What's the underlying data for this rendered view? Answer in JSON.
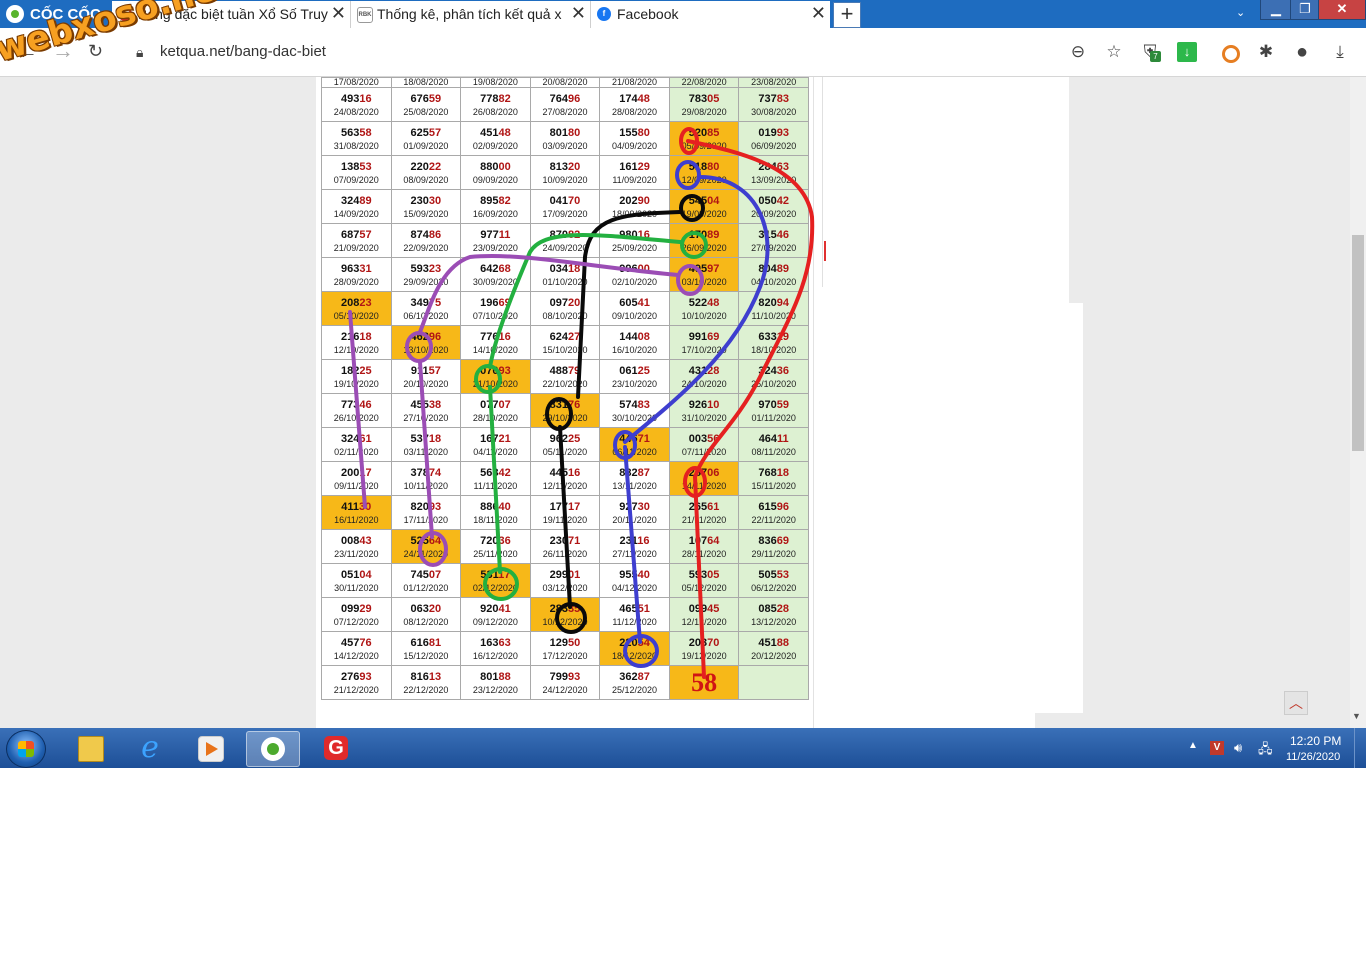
{
  "browser": {
    "brand": "CỐC CỐC",
    "tabs": [
      {
        "title": "Bảng đặc biệt tuần Xổ Số Truy"
      },
      {
        "title": "Thống kê, phân tích kết quả x"
      },
      {
        "title": "Facebook"
      }
    ],
    "new_tab": "+",
    "url": "ketqua.net/bang-dac-biet",
    "ext_badge": "7"
  },
  "watermark": "webxoso.net",
  "table": {
    "first_row": [
      "17/08/2020",
      "18/08/2020",
      "19/08/2020",
      "20/08/2020",
      "21/08/2020",
      "22/08/2020",
      "23/08/2020"
    ],
    "rows": [
      [
        [
          "49316",
          "24/08/2020"
        ],
        [
          "67659",
          "25/08/2020"
        ],
        [
          "77882",
          "26/08/2020"
        ],
        [
          "76496",
          "27/08/2020"
        ],
        [
          "17448",
          "28/08/2020"
        ],
        [
          "78305",
          "29/08/2020"
        ],
        [
          "73783",
          "30/08/2020"
        ]
      ],
      [
        [
          "56358",
          "31/08/2020"
        ],
        [
          "62557",
          "01/09/2020"
        ],
        [
          "45148",
          "02/09/2020"
        ],
        [
          "80180",
          "03/09/2020"
        ],
        [
          "15580",
          "04/09/2020"
        ],
        [
          "52085",
          "05/09/2020"
        ],
        [
          "01993",
          "06/09/2020"
        ]
      ],
      [
        [
          "13853",
          "07/09/2020"
        ],
        [
          "22022",
          "08/09/2020"
        ],
        [
          "88000",
          "09/09/2020"
        ],
        [
          "81320",
          "10/09/2020"
        ],
        [
          "16129",
          "11/09/2020"
        ],
        [
          "51880",
          "12/09/2020"
        ],
        [
          "28463",
          "13/09/2020"
        ]
      ],
      [
        [
          "32489",
          "14/09/2020"
        ],
        [
          "23030",
          "15/09/2020"
        ],
        [
          "89582",
          "16/09/2020"
        ],
        [
          "04170",
          "17/09/2020"
        ],
        [
          "20290",
          "18/09/2020"
        ],
        [
          "54504",
          "19/09/2020"
        ],
        [
          "05042",
          "20/09/2020"
        ]
      ],
      [
        [
          "68757",
          "21/09/2020"
        ],
        [
          "87486",
          "22/09/2020"
        ],
        [
          "97711",
          "23/09/2020"
        ],
        [
          "87082",
          "24/09/2020"
        ],
        [
          "98016",
          "25/09/2020"
        ],
        [
          "17089",
          "26/09/2020"
        ],
        [
          "31546",
          "27/09/2020"
        ]
      ],
      [
        [
          "96331",
          "28/09/2020"
        ],
        [
          "59323",
          "29/09/2020"
        ],
        [
          "64268",
          "30/09/2020"
        ],
        [
          "03418",
          "01/10/2020"
        ],
        [
          "99600",
          "02/10/2020"
        ],
        [
          "49597",
          "03/10/2020"
        ],
        [
          "80489",
          "04/10/2020"
        ]
      ],
      [
        [
          "20823",
          "05/10/2020"
        ],
        [
          "34975",
          "06/10/2020"
        ],
        [
          "19669",
          "07/10/2020"
        ],
        [
          "09720",
          "08/10/2020"
        ],
        [
          "60541",
          "09/10/2020"
        ],
        [
          "52248",
          "10/10/2020"
        ],
        [
          "82094",
          "11/10/2020"
        ]
      ],
      [
        [
          "21618",
          "12/10/2020"
        ],
        [
          "46296",
          "13/10/2020"
        ],
        [
          "77616",
          "14/10/2020"
        ],
        [
          "62427",
          "15/10/2020"
        ],
        [
          "14408",
          "16/10/2020"
        ],
        [
          "99169",
          "17/10/2020"
        ],
        [
          "63319",
          "18/10/2020"
        ]
      ],
      [
        [
          "18225",
          "19/10/2020"
        ],
        [
          "91157",
          "20/10/2020"
        ],
        [
          "07093",
          "21/10/2020"
        ],
        [
          "48879",
          "22/10/2020"
        ],
        [
          "06125",
          "23/10/2020"
        ],
        [
          "43128",
          "24/10/2020"
        ],
        [
          "32436",
          "25/10/2020"
        ]
      ],
      [
        [
          "77346",
          "26/10/2020"
        ],
        [
          "45538",
          "27/10/2020"
        ],
        [
          "07707",
          "28/10/2020"
        ],
        [
          "83176",
          "29/10/2020"
        ],
        [
          "57483",
          "30/10/2020"
        ],
        [
          "92610",
          "31/10/2020"
        ],
        [
          "97059",
          "01/11/2020"
        ]
      ],
      [
        [
          "32461",
          "02/11/2020"
        ],
        [
          "53718",
          "03/11/2020"
        ],
        [
          "16721",
          "04/11/2020"
        ],
        [
          "96225",
          "05/11/2020"
        ],
        [
          "44671",
          "06/11/2020"
        ],
        [
          "00356",
          "07/11/2020"
        ],
        [
          "46411",
          "08/11/2020"
        ]
      ],
      [
        [
          "20017",
          "09/11/2020"
        ],
        [
          "37874",
          "10/11/2020"
        ],
        [
          "56842",
          "11/11/2020"
        ],
        [
          "44516",
          "12/11/2020"
        ],
        [
          "88287",
          "13/11/2020"
        ],
        [
          "28706",
          "14/11/2020"
        ],
        [
          "76818",
          "15/11/2020"
        ]
      ],
      [
        [
          "41130",
          "16/11/2020"
        ],
        [
          "82093",
          "17/11/2020"
        ],
        [
          "88640",
          "18/11/2020"
        ],
        [
          "17717",
          "19/11/2020"
        ],
        [
          "92730",
          "20/11/2020"
        ],
        [
          "26561",
          "21/11/2020"
        ],
        [
          "61596",
          "22/11/2020"
        ]
      ],
      [
        [
          "00843",
          "23/11/2020"
        ],
        [
          "52564",
          "24/11/2020"
        ],
        [
          "72036",
          "25/11/2020"
        ],
        [
          "23071",
          "26/11/2020"
        ],
        [
          "23116",
          "27/11/2020"
        ],
        [
          "10764",
          "28/11/2020"
        ],
        [
          "83669",
          "29/11/2020"
        ]
      ],
      [
        [
          "05104",
          "30/11/2020"
        ],
        [
          "74507",
          "01/12/2020"
        ],
        [
          "53117",
          "02/12/2020"
        ],
        [
          "29901",
          "03/12/2020"
        ],
        [
          "95540",
          "04/12/2020"
        ],
        [
          "59305",
          "05/12/2020"
        ],
        [
          "50553",
          "06/12/2020"
        ]
      ],
      [
        [
          "09929",
          "07/12/2020"
        ],
        [
          "06320",
          "08/12/2020"
        ],
        [
          "92041",
          "09/12/2020"
        ],
        [
          "28335",
          "10/12/2020"
        ],
        [
          "46551",
          "11/12/2020"
        ],
        [
          "09945",
          "12/12/2020"
        ],
        [
          "08528",
          "13/12/2020"
        ]
      ],
      [
        [
          "45776",
          "14/12/2020"
        ],
        [
          "61681",
          "15/12/2020"
        ],
        [
          "16363",
          "16/12/2020"
        ],
        [
          "12950",
          "17/12/2020"
        ],
        [
          "22054",
          "18/12/2020"
        ],
        [
          "20370",
          "19/12/2020"
        ],
        [
          "45188",
          "20/12/2020"
        ]
      ],
      [
        [
          "27693",
          "21/12/2020"
        ],
        [
          "81613",
          "22/12/2020"
        ],
        [
          "80188",
          "23/12/2020"
        ],
        [
          "79993",
          "24/12/2020"
        ],
        [
          "36287",
          "25/12/2020"
        ],
        [
          "58",
          ""
        ],
        [
          "",
          ""
        ]
      ]
    ],
    "highlighted": [
      [
        1,
        5
      ],
      [
        2,
        5
      ],
      [
        3,
        5
      ],
      [
        4,
        5
      ],
      [
        5,
        5
      ],
      [
        6,
        0
      ],
      [
        7,
        1
      ],
      [
        8,
        2
      ],
      [
        9,
        3
      ],
      [
        10,
        4
      ],
      [
        11,
        5
      ],
      [
        12,
        0
      ],
      [
        13,
        1
      ],
      [
        14,
        2
      ],
      [
        15,
        3
      ],
      [
        16,
        4
      ],
      [
        17,
        5
      ]
    ],
    "prediction": "58"
  },
  "annotation_colors": {
    "red": "#e52020",
    "blue": "#3e3ecf",
    "black": "#0a0a0a",
    "green": "#23b040",
    "purple": "#9b4db5"
  },
  "taskbar": {
    "time": "12:20 PM",
    "date": "11/26/2020"
  }
}
